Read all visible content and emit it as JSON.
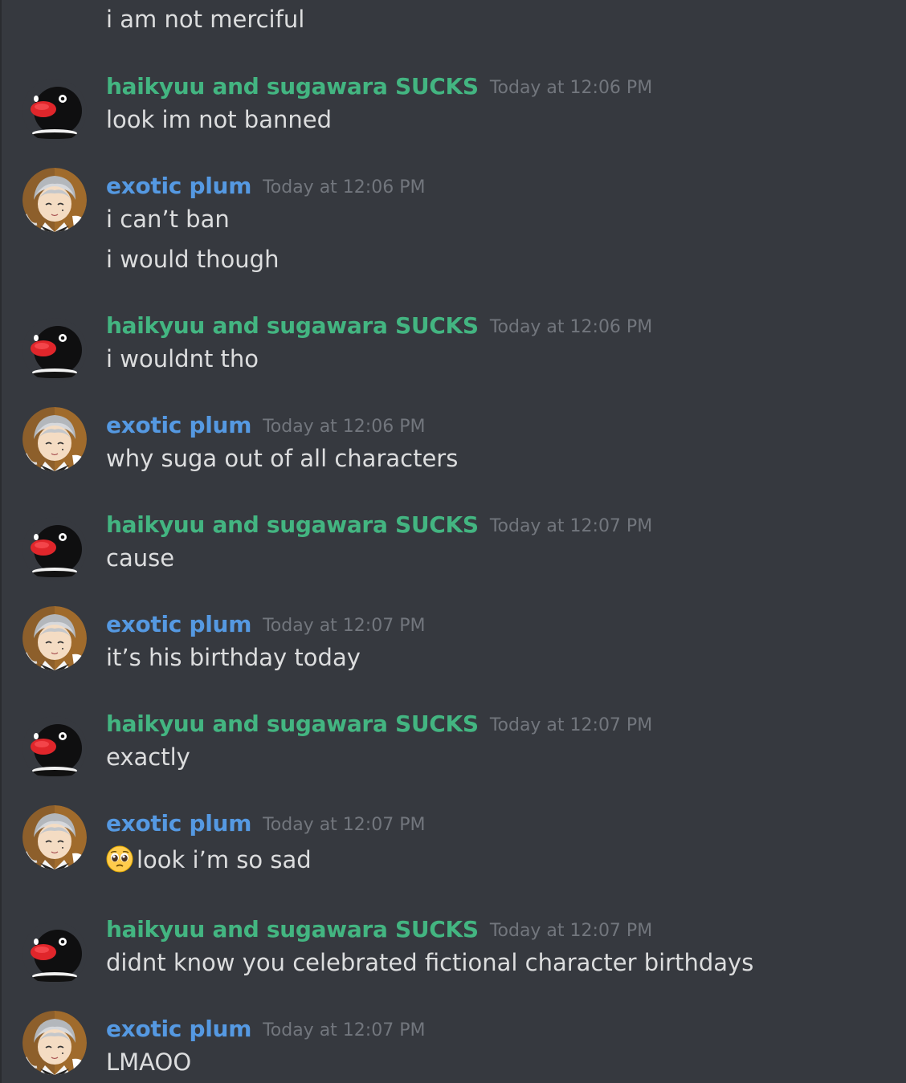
{
  "colors": {
    "background": "#36393f",
    "username_user1": "#43b581",
    "username_user2": "#5599e2",
    "timestamp": "#72767d",
    "text": "#dcddde"
  },
  "top_line": "i am not merciful",
  "messages": [
    {
      "author": "haikyuu and sugawara SUCKS",
      "avatar_icon": "penguin-avatar",
      "time": "Today at 12:06 PM",
      "lines": [
        "look im not banned"
      ]
    },
    {
      "author": "exotic plum",
      "avatar_icon": "anime-character-avatar",
      "time": "Today at 12:06 PM",
      "lines": [
        "i can’t ban",
        "i would though"
      ]
    },
    {
      "author": "haikyuu and sugawara SUCKS",
      "avatar_icon": "penguin-avatar",
      "time": "Today at 12:06 PM",
      "lines": [
        "i wouldnt tho"
      ]
    },
    {
      "author": "exotic plum",
      "avatar_icon": "anime-character-avatar",
      "time": "Today at 12:06 PM",
      "lines": [
        "why suga out of all characters"
      ]
    },
    {
      "author": "haikyuu and sugawara SUCKS",
      "avatar_icon": "penguin-avatar",
      "time": "Today at 12:07 PM",
      "lines": [
        "cause"
      ]
    },
    {
      "author": "exotic plum",
      "avatar_icon": "anime-character-avatar",
      "time": "Today at 12:07 PM",
      "lines": [
        "it’s his birthday today"
      ]
    },
    {
      "author": "haikyuu and sugawara SUCKS",
      "avatar_icon": "penguin-avatar",
      "time": "Today at 12:07 PM",
      "lines": [
        "exactly"
      ]
    },
    {
      "author": "exotic plum",
      "avatar_icon": "anime-character-avatar",
      "time": "Today at 12:07 PM",
      "lines": [
        "look i’m so sad"
      ],
      "emoji": "pleading-face-emoji"
    },
    {
      "author": "haikyuu and sugawara SUCKS",
      "avatar_icon": "penguin-avatar",
      "time": "Today at 12:07 PM",
      "lines": [
        "didnt know you celebrated fictional character birthdays"
      ]
    },
    {
      "author": "exotic plum",
      "avatar_icon": "anime-character-avatar",
      "time": "Today at 12:07 PM",
      "lines": [
        "LMAOO"
      ]
    }
  ]
}
